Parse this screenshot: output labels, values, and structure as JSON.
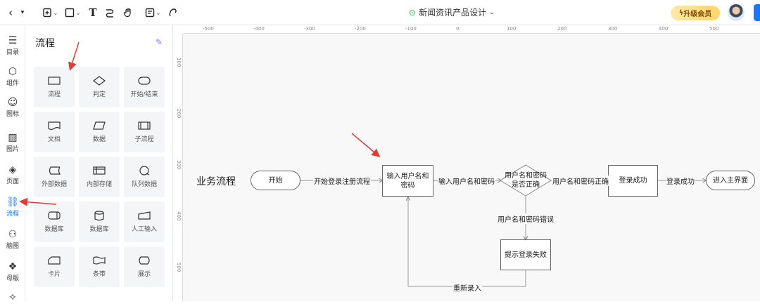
{
  "doc": {
    "title": "新闻资讯产品设计",
    "vip": "升级会员"
  },
  "rail": [
    {
      "label": "目录",
      "icon": "list-icon"
    },
    {
      "label": "组件",
      "icon": "component-icon"
    },
    {
      "label": "图标",
      "icon": "smile-icon"
    },
    {
      "label": "图片",
      "icon": "image-icon"
    },
    {
      "label": "页面",
      "icon": "page-icon"
    },
    {
      "label": "流程",
      "icon": "flow-icon"
    },
    {
      "label": "脑图",
      "icon": "mindmap-icon"
    },
    {
      "label": "母版",
      "icon": "master-icon"
    }
  ],
  "panel": {
    "title": "流程",
    "shapes": [
      {
        "label": "流程"
      },
      {
        "label": "判定"
      },
      {
        "label": "开始/结束"
      },
      {
        "label": "文档"
      },
      {
        "label": "数据"
      },
      {
        "label": "子流程"
      },
      {
        "label": "外部数据"
      },
      {
        "label": "内部存储"
      },
      {
        "label": "队列数据"
      },
      {
        "label": "数据库"
      },
      {
        "label": "数据库"
      },
      {
        "label": "人工输入"
      },
      {
        "label": "卡片"
      },
      {
        "label": "条带"
      },
      {
        "label": "展示"
      }
    ]
  },
  "rulers": {
    "top": [
      "-500",
      "-400",
      "-300",
      "-200",
      "-100",
      "0",
      "100",
      "200",
      "300",
      "400",
      "500"
    ],
    "left": [
      "100",
      "200",
      "300",
      "400",
      "500"
    ]
  },
  "flow": {
    "title": "业务流程",
    "nodes": {
      "start": "开始",
      "input": "输入用户名和密码",
      "check": "用户名和密码是否正确",
      "success": "登录成功",
      "main": "进入主界面",
      "fail": "提示登录失败"
    },
    "edges": {
      "e1": "开始登录注册流程",
      "e2": "输入用户名和密码",
      "e3": "用户名和密码正确",
      "e4": "登录成功",
      "e5": "用户名和密码错误",
      "e6": "重新录入"
    }
  }
}
